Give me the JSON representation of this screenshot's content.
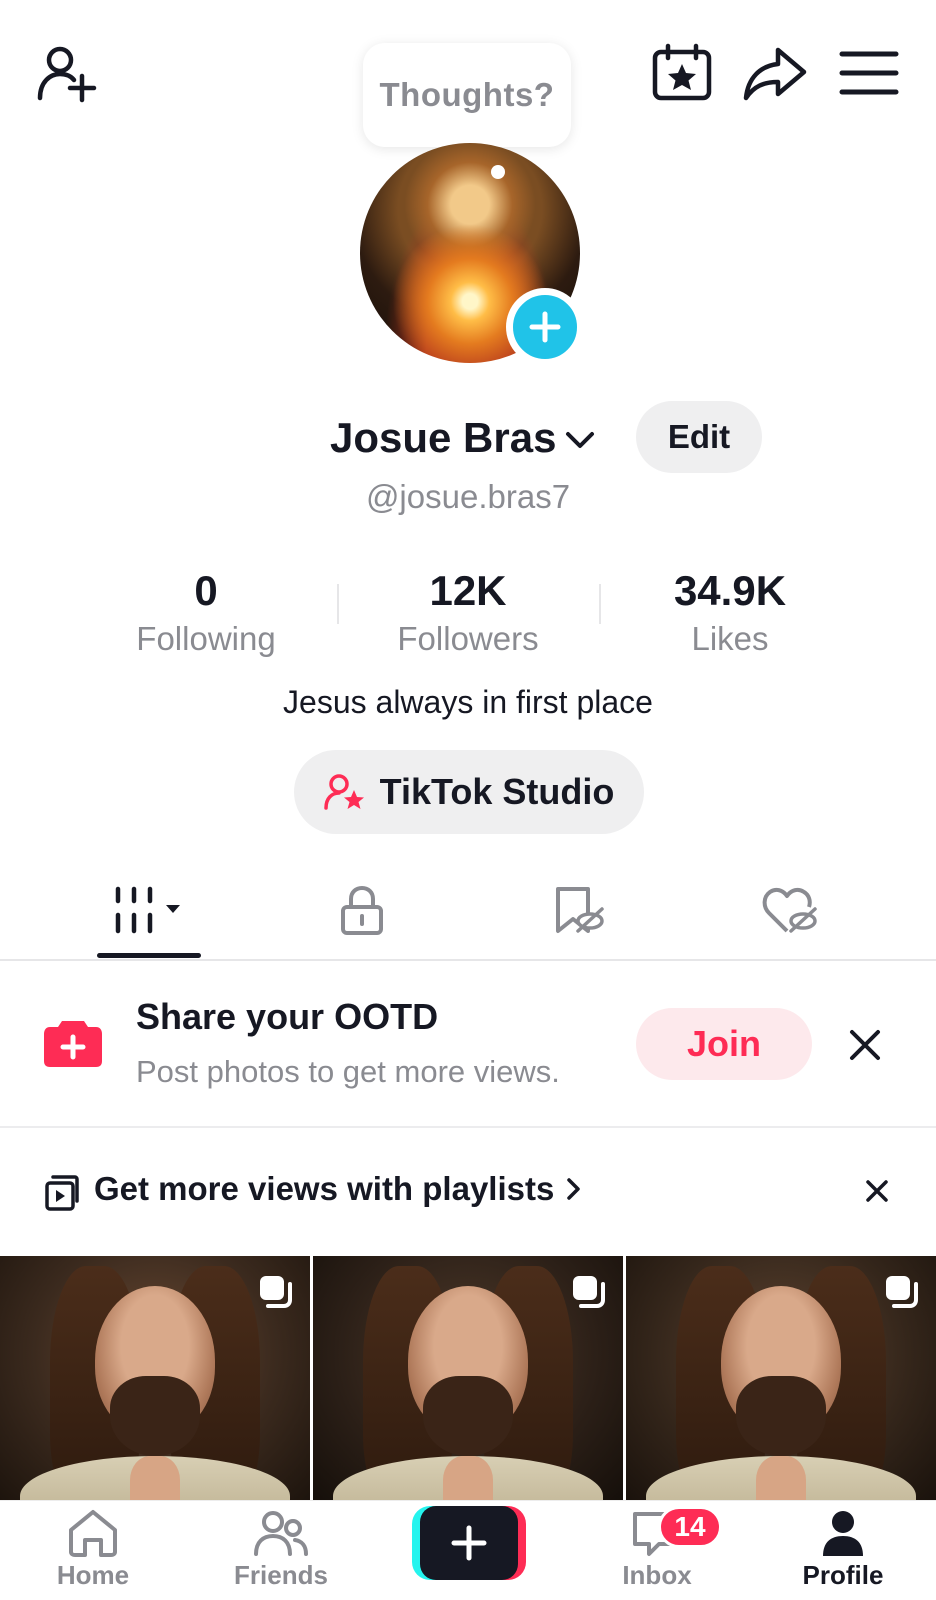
{
  "header": {
    "thought_bubble": "Thoughts?",
    "icons": [
      "add-friend-icon",
      "calendar-star-icon",
      "share-icon",
      "menu-icon"
    ]
  },
  "profile": {
    "display_name": "Josue Bras",
    "edit_label": "Edit",
    "username": "@josue.bras7",
    "stats": [
      {
        "value": "0",
        "label": "Following"
      },
      {
        "value": "12K",
        "label": "Followers"
      },
      {
        "value": "34.9K",
        "label": "Likes"
      }
    ],
    "bio": "Jesus always in first place",
    "studio_label": "TikTok Studio"
  },
  "tabs": [
    "videos-grid",
    "private",
    "saved",
    "liked"
  ],
  "ootd": {
    "title": "Share your OOTD",
    "subtitle": "Post photos to get more views.",
    "join_label": "Join"
  },
  "playlists": {
    "text": "Get more views with playlists"
  },
  "nav": {
    "items": [
      {
        "label": "Home"
      },
      {
        "label": "Friends"
      },
      {
        "label": "Inbox"
      },
      {
        "label": "Profile"
      }
    ],
    "inbox_badge": "14"
  },
  "colors": {
    "accent_red": "#fe2c55",
    "accent_cyan": "#20c3e8",
    "text_primary": "#161823",
    "text_secondary": "#8a8b91"
  }
}
